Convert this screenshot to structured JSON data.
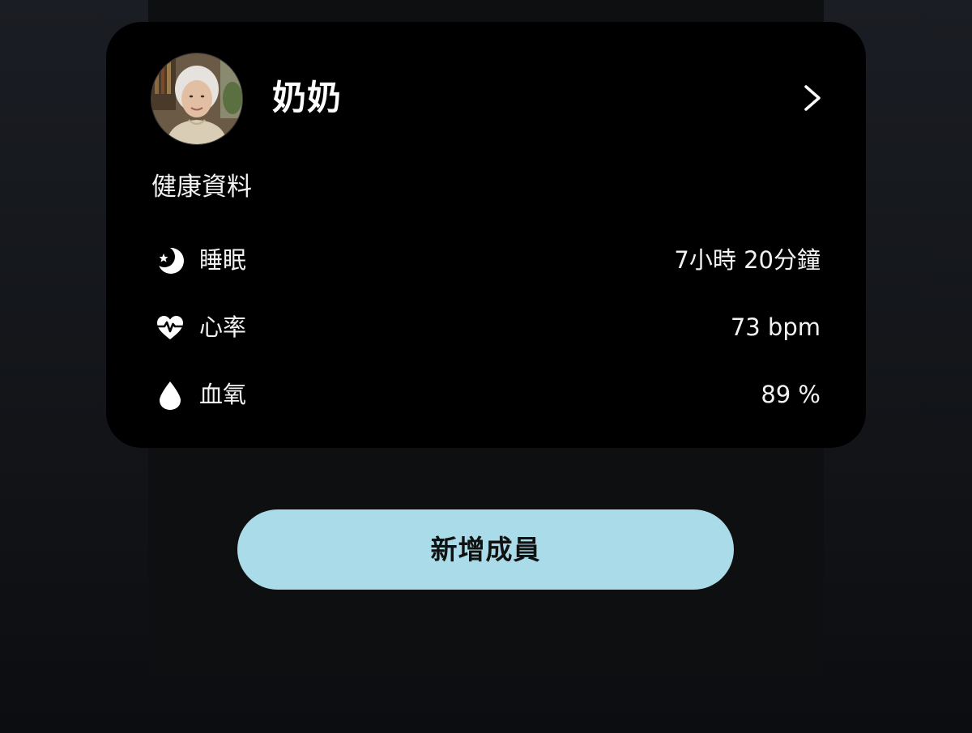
{
  "member": {
    "name": "奶奶",
    "avatar_icon": "profile-photo",
    "open_icon": "chevron-right-icon"
  },
  "health": {
    "title": "健康資料",
    "metrics": [
      {
        "icon": "moon-icon",
        "label": "睡眠",
        "value": "7小時 20分鐘"
      },
      {
        "icon": "heart-rate-icon",
        "label": "心率",
        "value": "73 bpm"
      },
      {
        "icon": "drop-icon",
        "label": "血氧",
        "value": "89 %"
      }
    ]
  },
  "actions": {
    "add_member_label": "新增成員"
  },
  "colors": {
    "card_background": "#000000",
    "button_background": "#a9dbe8",
    "text_primary": "#ffffff"
  }
}
